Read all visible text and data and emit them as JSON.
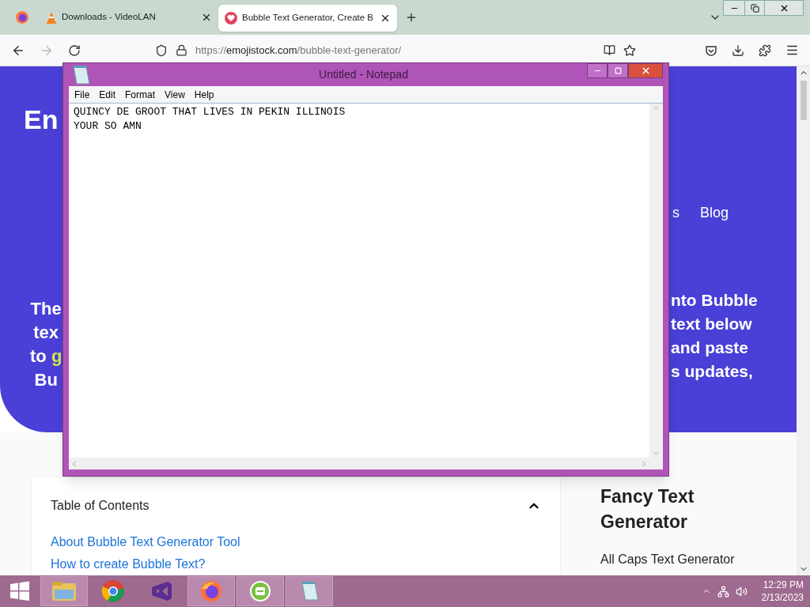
{
  "browser": {
    "tabs": [
      {
        "title": "Downloads - VideoLAN",
        "selected": false
      },
      {
        "title": "Bubble Text Generator, Create B",
        "selected": true
      }
    ],
    "url": {
      "scheme": "https://",
      "host": "emojistock.com",
      "path": "/bubble-text-generator/"
    }
  },
  "page": {
    "logo": "En",
    "nav": [
      {
        "text": "s"
      },
      {
        "text": "Blog"
      }
    ],
    "hero_left": [
      {
        "text": "The"
      },
      {
        "text": "tex"
      },
      {
        "text": "to ",
        "accent": "g"
      },
      {
        "text": "Bu"
      }
    ],
    "hero_right": [
      {
        "text": "nto Bubble"
      },
      {
        "text": "text below"
      },
      {
        "text": "and paste"
      },
      {
        "text": "s updates,"
      }
    ],
    "toc": {
      "title": "Table of Contents",
      "expanded": true,
      "links": [
        "About Bubble Text Generator Tool",
        "How to create Bubble Text?"
      ]
    },
    "sidebar": {
      "title": "Fancy Text Generator",
      "links": [
        "All Caps Text Generator"
      ]
    }
  },
  "notepad": {
    "title": "Untitled - Notepad",
    "menu": [
      "File",
      "Edit",
      "Format",
      "View",
      "Help"
    ],
    "lines": [
      "QUINCY DE GROOT THAT LIVES IN PEKIN ILLINOIS",
      "YOUR SO AMN"
    ]
  },
  "taskbar": {
    "apps": [
      {
        "kind": "explorer",
        "active": true
      },
      {
        "kind": "chrome",
        "active": false
      },
      {
        "kind": "studio",
        "active": false
      },
      {
        "kind": "firefox",
        "active": true
      },
      {
        "kind": "green",
        "active": true
      },
      {
        "kind": "notepad",
        "active": true
      }
    ],
    "time": "12:29 PM",
    "date": "2/13/2023"
  }
}
